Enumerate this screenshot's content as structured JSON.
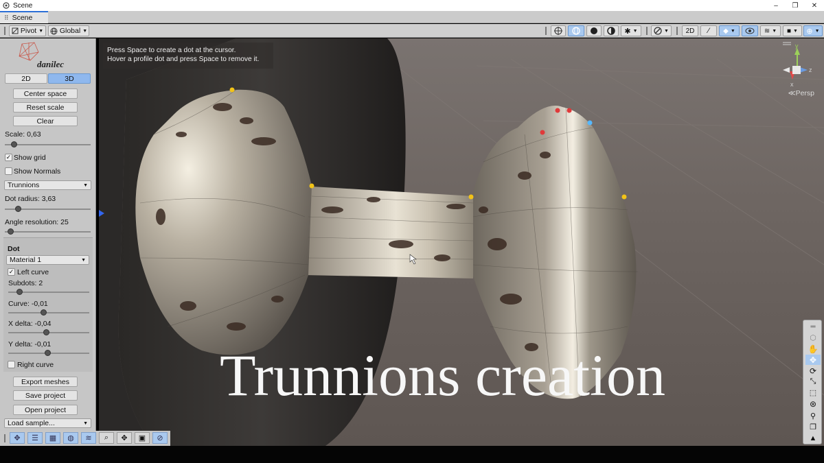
{
  "window": {
    "title": "Scene",
    "controls": {
      "minimize": "–",
      "restore": "❐",
      "close": "✕"
    }
  },
  "tab": {
    "label": "Scene"
  },
  "toolbar": {
    "pivot_label": "Pivot",
    "global_label": "Global"
  },
  "hint": {
    "line1": "Press Space to create a dot at the cursor.",
    "line2": "Hover a profile dot and press Space to remove it."
  },
  "caption": "Trunnions creation",
  "gizmo": {
    "persp_label": "Persp",
    "axis_x": "x",
    "axis_y": "y",
    "axis_z": "z"
  },
  "panel": {
    "logo_text": "danilec",
    "mode_2d": "2D",
    "mode_3d": "3D",
    "active_mode": "3D",
    "center_space": "Center space",
    "reset_scale": "Reset scale",
    "clear": "Clear",
    "scale_label": "Scale: 0,63",
    "show_grid_label": "Show grid",
    "show_grid_checked": true,
    "show_normals_label": "Show Normals",
    "show_normals_checked": false,
    "shape_select": "Trunnions",
    "dot_radius_label": "Dot radius: 3,63",
    "angle_resolution_label": "Angle resolution: 25",
    "dot": {
      "heading": "Dot",
      "material_select": "Material 1",
      "left_curve_label": "Left curve",
      "left_curve_checked": true,
      "subdots_label": "Subdots: 2",
      "curve_label": "Curve: -0,01",
      "x_delta_label": "X delta: -0,04",
      "y_delta_label": "Y delta: -0,01",
      "right_curve_label": "Right curve",
      "right_curve_checked": false
    },
    "export_meshes": "Export meshes",
    "save_project": "Save project",
    "open_project": "Open project",
    "load_sample": "Load sample..."
  },
  "colors": {
    "accent": "#2c6fd6",
    "active_button": "#a9c9ef",
    "dot_yellow": "#f2c318",
    "dot_red": "#e03a3a",
    "dot_blue": "#56b8ff",
    "background": "#6e6763"
  }
}
